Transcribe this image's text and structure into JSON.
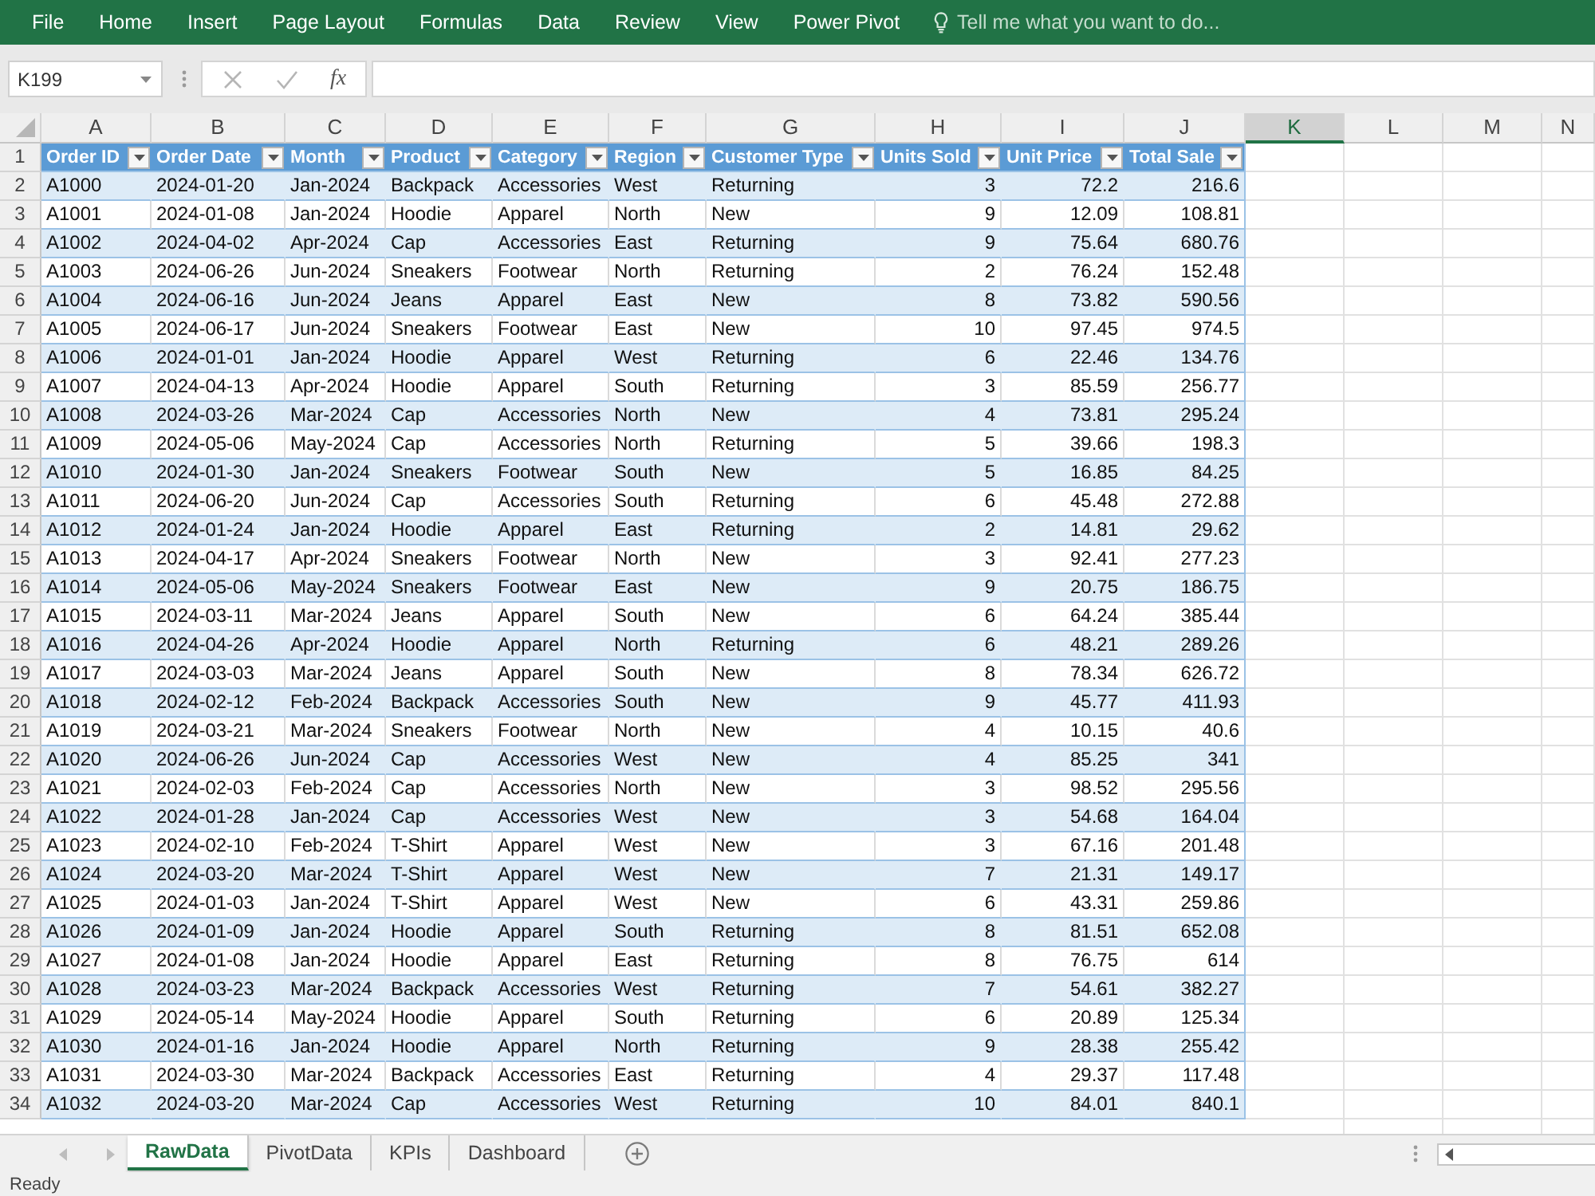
{
  "menu_bar": {
    "tabs": [
      "File",
      "Home",
      "Insert",
      "Page Layout",
      "Formulas",
      "Data",
      "Review",
      "View",
      "Power Pivot"
    ],
    "search": {
      "placeholder": "Tell me what you want to do..."
    }
  },
  "formula_bar": {
    "name_box": "K199",
    "function_button": "fx"
  },
  "sheet": {
    "columns": [
      {
        "label": "A",
        "selected": false
      },
      {
        "label": "B",
        "selected": false
      },
      {
        "label": "C",
        "selected": false
      },
      {
        "label": "D",
        "selected": false
      },
      {
        "label": "E",
        "selected": false
      },
      {
        "label": "F",
        "selected": false
      },
      {
        "label": "G",
        "selected": false
      },
      {
        "label": "H",
        "selected": false
      },
      {
        "label": "I",
        "selected": false
      },
      {
        "label": "J",
        "selected": false
      },
      {
        "label": "K",
        "selected": true
      },
      {
        "label": "L",
        "selected": false
      },
      {
        "label": "M",
        "selected": false
      },
      {
        "label": "N",
        "selected": false
      }
    ],
    "table": {
      "header_row": "1",
      "columns": [
        {
          "label": "Order ID",
          "kind": "text"
        },
        {
          "label": "Order Date",
          "kind": "text"
        },
        {
          "label": "Month",
          "kind": "text"
        },
        {
          "label": "Product",
          "kind": "text"
        },
        {
          "label": "Category",
          "kind": "text"
        },
        {
          "label": "Region",
          "kind": "text"
        },
        {
          "label": "Customer Type",
          "kind": "text"
        },
        {
          "label": "Units Sold",
          "kind": "number"
        },
        {
          "label": "Unit Price",
          "kind": "number"
        },
        {
          "label": "Total Sale",
          "kind": "number"
        }
      ],
      "rows": [
        {
          "row": "2",
          "cells": [
            "A1000",
            "2024-01-20",
            "Jan-2024",
            "Backpack",
            "Accessories",
            "West",
            "Returning",
            "3",
            "72.2",
            "216.6"
          ]
        },
        {
          "row": "3",
          "cells": [
            "A1001",
            "2024-01-08",
            "Jan-2024",
            "Hoodie",
            "Apparel",
            "North",
            "New",
            "9",
            "12.09",
            "108.81"
          ]
        },
        {
          "row": "4",
          "cells": [
            "A1002",
            "2024-04-02",
            "Apr-2024",
            "Cap",
            "Accessories",
            "East",
            "Returning",
            "9",
            "75.64",
            "680.76"
          ]
        },
        {
          "row": "5",
          "cells": [
            "A1003",
            "2024-06-26",
            "Jun-2024",
            "Sneakers",
            "Footwear",
            "North",
            "Returning",
            "2",
            "76.24",
            "152.48"
          ]
        },
        {
          "row": "6",
          "cells": [
            "A1004",
            "2024-06-16",
            "Jun-2024",
            "Jeans",
            "Apparel",
            "East",
            "New",
            "8",
            "73.82",
            "590.56"
          ]
        },
        {
          "row": "7",
          "cells": [
            "A1005",
            "2024-06-17",
            "Jun-2024",
            "Sneakers",
            "Footwear",
            "East",
            "New",
            "10",
            "97.45",
            "974.5"
          ]
        },
        {
          "row": "8",
          "cells": [
            "A1006",
            "2024-01-01",
            "Jan-2024",
            "Hoodie",
            "Apparel",
            "West",
            "Returning",
            "6",
            "22.46",
            "134.76"
          ]
        },
        {
          "row": "9",
          "cells": [
            "A1007",
            "2024-04-13",
            "Apr-2024",
            "Hoodie",
            "Apparel",
            "South",
            "Returning",
            "3",
            "85.59",
            "256.77"
          ]
        },
        {
          "row": "10",
          "cells": [
            "A1008",
            "2024-03-26",
            "Mar-2024",
            "Cap",
            "Accessories",
            "North",
            "New",
            "4",
            "73.81",
            "295.24"
          ]
        },
        {
          "row": "11",
          "cells": [
            "A1009",
            "2024-05-06",
            "May-2024",
            "Cap",
            "Accessories",
            "North",
            "Returning",
            "5",
            "39.66",
            "198.3"
          ]
        },
        {
          "row": "12",
          "cells": [
            "A1010",
            "2024-01-30",
            "Jan-2024",
            "Sneakers",
            "Footwear",
            "South",
            "New",
            "5",
            "16.85",
            "84.25"
          ]
        },
        {
          "row": "13",
          "cells": [
            "A1011",
            "2024-06-20",
            "Jun-2024",
            "Cap",
            "Accessories",
            "South",
            "Returning",
            "6",
            "45.48",
            "272.88"
          ]
        },
        {
          "row": "14",
          "cells": [
            "A1012",
            "2024-01-24",
            "Jan-2024",
            "Hoodie",
            "Apparel",
            "East",
            "Returning",
            "2",
            "14.81",
            "29.62"
          ]
        },
        {
          "row": "15",
          "cells": [
            "A1013",
            "2024-04-17",
            "Apr-2024",
            "Sneakers",
            "Footwear",
            "North",
            "New",
            "3",
            "92.41",
            "277.23"
          ]
        },
        {
          "row": "16",
          "cells": [
            "A1014",
            "2024-05-06",
            "May-2024",
            "Sneakers",
            "Footwear",
            "East",
            "New",
            "9",
            "20.75",
            "186.75"
          ]
        },
        {
          "row": "17",
          "cells": [
            "A1015",
            "2024-03-11",
            "Mar-2024",
            "Jeans",
            "Apparel",
            "South",
            "New",
            "6",
            "64.24",
            "385.44"
          ]
        },
        {
          "row": "18",
          "cells": [
            "A1016",
            "2024-04-26",
            "Apr-2024",
            "Hoodie",
            "Apparel",
            "North",
            "Returning",
            "6",
            "48.21",
            "289.26"
          ]
        },
        {
          "row": "19",
          "cells": [
            "A1017",
            "2024-03-03",
            "Mar-2024",
            "Jeans",
            "Apparel",
            "South",
            "New",
            "8",
            "78.34",
            "626.72"
          ]
        },
        {
          "row": "20",
          "cells": [
            "A1018",
            "2024-02-12",
            "Feb-2024",
            "Backpack",
            "Accessories",
            "South",
            "New",
            "9",
            "45.77",
            "411.93"
          ]
        },
        {
          "row": "21",
          "cells": [
            "A1019",
            "2024-03-21",
            "Mar-2024",
            "Sneakers",
            "Footwear",
            "North",
            "New",
            "4",
            "10.15",
            "40.6"
          ]
        },
        {
          "row": "22",
          "cells": [
            "A1020",
            "2024-06-26",
            "Jun-2024",
            "Cap",
            "Accessories",
            "West",
            "New",
            "4",
            "85.25",
            "341"
          ]
        },
        {
          "row": "23",
          "cells": [
            "A1021",
            "2024-02-03",
            "Feb-2024",
            "Cap",
            "Accessories",
            "North",
            "New",
            "3",
            "98.52",
            "295.56"
          ]
        },
        {
          "row": "24",
          "cells": [
            "A1022",
            "2024-01-28",
            "Jan-2024",
            "Cap",
            "Accessories",
            "West",
            "New",
            "3",
            "54.68",
            "164.04"
          ]
        },
        {
          "row": "25",
          "cells": [
            "A1023",
            "2024-02-10",
            "Feb-2024",
            "T-Shirt",
            "Apparel",
            "West",
            "New",
            "3",
            "67.16",
            "201.48"
          ]
        },
        {
          "row": "26",
          "cells": [
            "A1024",
            "2024-03-20",
            "Mar-2024",
            "T-Shirt",
            "Apparel",
            "West",
            "New",
            "7",
            "21.31",
            "149.17"
          ]
        },
        {
          "row": "27",
          "cells": [
            "A1025",
            "2024-01-03",
            "Jan-2024",
            "T-Shirt",
            "Apparel",
            "West",
            "New",
            "6",
            "43.31",
            "259.86"
          ]
        },
        {
          "row": "28",
          "cells": [
            "A1026",
            "2024-01-09",
            "Jan-2024",
            "Hoodie",
            "Apparel",
            "South",
            "Returning",
            "8",
            "81.51",
            "652.08"
          ]
        },
        {
          "row": "29",
          "cells": [
            "A1027",
            "2024-01-08",
            "Jan-2024",
            "Hoodie",
            "Apparel",
            "East",
            "Returning",
            "8",
            "76.75",
            "614"
          ]
        },
        {
          "row": "30",
          "cells": [
            "A1028",
            "2024-03-23",
            "Mar-2024",
            "Backpack",
            "Accessories",
            "West",
            "Returning",
            "7",
            "54.61",
            "382.27"
          ]
        },
        {
          "row": "31",
          "cells": [
            "A1029",
            "2024-05-14",
            "May-2024",
            "Hoodie",
            "Apparel",
            "South",
            "Returning",
            "6",
            "20.89",
            "125.34"
          ]
        },
        {
          "row": "32",
          "cells": [
            "A1030",
            "2024-01-16",
            "Jan-2024",
            "Hoodie",
            "Apparel",
            "North",
            "Returning",
            "9",
            "28.38",
            "255.42"
          ]
        },
        {
          "row": "33",
          "cells": [
            "A1031",
            "2024-03-30",
            "Mar-2024",
            "Backpack",
            "Accessories",
            "East",
            "Returning",
            "4",
            "29.37",
            "117.48"
          ]
        },
        {
          "row": "34",
          "cells": [
            "A1032",
            "2024-03-20",
            "Mar-2024",
            "Cap",
            "Accessories",
            "West",
            "Returning",
            "10",
            "84.01",
            "840.1"
          ]
        }
      ]
    }
  },
  "sheet_tabs": [
    {
      "label": "RawData",
      "selected": true
    },
    {
      "label": "PivotData",
      "selected": false
    },
    {
      "label": "KPIs",
      "selected": false
    },
    {
      "label": "Dashboard",
      "selected": false
    }
  ],
  "status_bar": {
    "text": "Ready"
  }
}
